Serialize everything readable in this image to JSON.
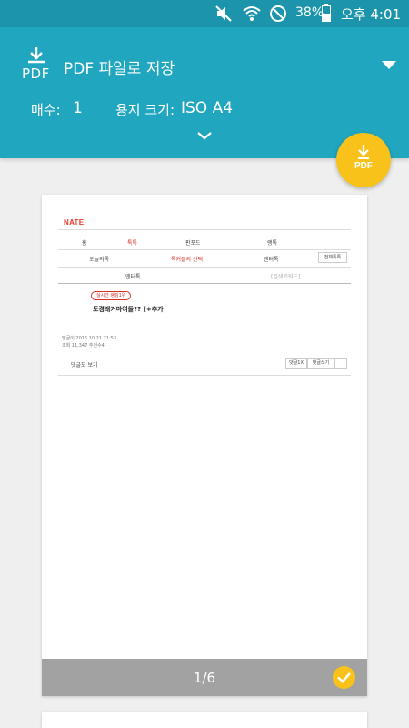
{
  "status_bar": {
    "battery": "38%",
    "time": "오후 4:01",
    "icons": [
      "mute-icon",
      "wifi-icon",
      "do-not-disturb-icon",
      "battery-icon"
    ]
  },
  "header": {
    "icon_label": "PDF",
    "title": "PDF 파일로 저장",
    "copies_label": "매수:",
    "copies_value": "1",
    "paper_size_label": "용지 크기:",
    "paper_size_value": "ISO A4"
  },
  "fab": {
    "label": "PDF"
  },
  "preview": {
    "page_counter": "1/6",
    "web": {
      "logo": "NATE",
      "nav_tabs": [
        "홈",
        "톡톡",
        "판포드",
        "랭톡"
      ],
      "sub_nav": [
        "오늘의톡",
        "톡커들의 선택",
        "엔터톡"
      ],
      "all_button": "전체톡톡",
      "third_row": "엔터톡",
      "search_placeholder": "[검색키워드]",
      "tag": "실시간 랭킹1위",
      "post_title": "도경래거마여돌?? [+추가",
      "meta_line1": "방금이   2016.10.21 21:53",
      "meta_line2": "조회 11,347  추천수4",
      "comment_label": "댓글모 보기",
      "btn1": "댓글1X",
      "btn2": "댓글쓰기"
    }
  },
  "colors": {
    "header_bg": "#20a6bf",
    "status_bg": "#1c95ac",
    "accent_yellow": "#f8c21b",
    "page_bg": "#efefef"
  }
}
